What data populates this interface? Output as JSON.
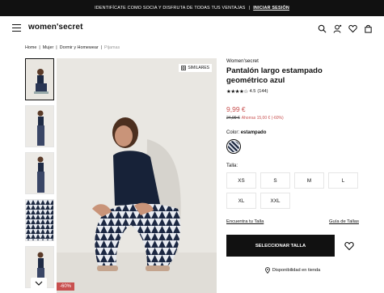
{
  "promo": {
    "text": "IDENTIFÍCATE COMO SOCIA Y DISFRUTA DE TODAS TUS VENTAJAS",
    "separator": "|",
    "link": "INICIAR SESIÓN"
  },
  "header": {
    "logo": "women'secret",
    "icons": [
      "menu-icon",
      "search-icon",
      "user-icon",
      "heart-icon",
      "bag-icon"
    ]
  },
  "breadcrumbs": [
    "Home",
    "Mujer",
    "Dormir y Homewear",
    "Pijamas"
  ],
  "breadcrumb_separator": "|",
  "gallery": {
    "similares": "SIMILARES",
    "discount_badge": "-60%",
    "thumb_count": 5
  },
  "product": {
    "brand": "Women'secret",
    "title": "Pantalón largo estampado geométrico azul",
    "rating": "4.5",
    "reviews": "(144)",
    "price": "9,99 €",
    "old_price": "24,99 €",
    "savings": "Ahorras 15,00 € (-60%)",
    "color_label": "Color:",
    "color_value": "estampado",
    "size_label": "Talla:",
    "sizes": [
      "XS",
      "S",
      "M",
      "L",
      "XL",
      "XXL"
    ],
    "find_size": "Encuentra tu Talla",
    "size_guide": "Guía de Tallas",
    "select_size": "SELECCIONAR TALLA",
    "availability": "Disponibilidad en tienda"
  },
  "colors": {
    "accent": "#c8504f",
    "dark": "#111111"
  }
}
